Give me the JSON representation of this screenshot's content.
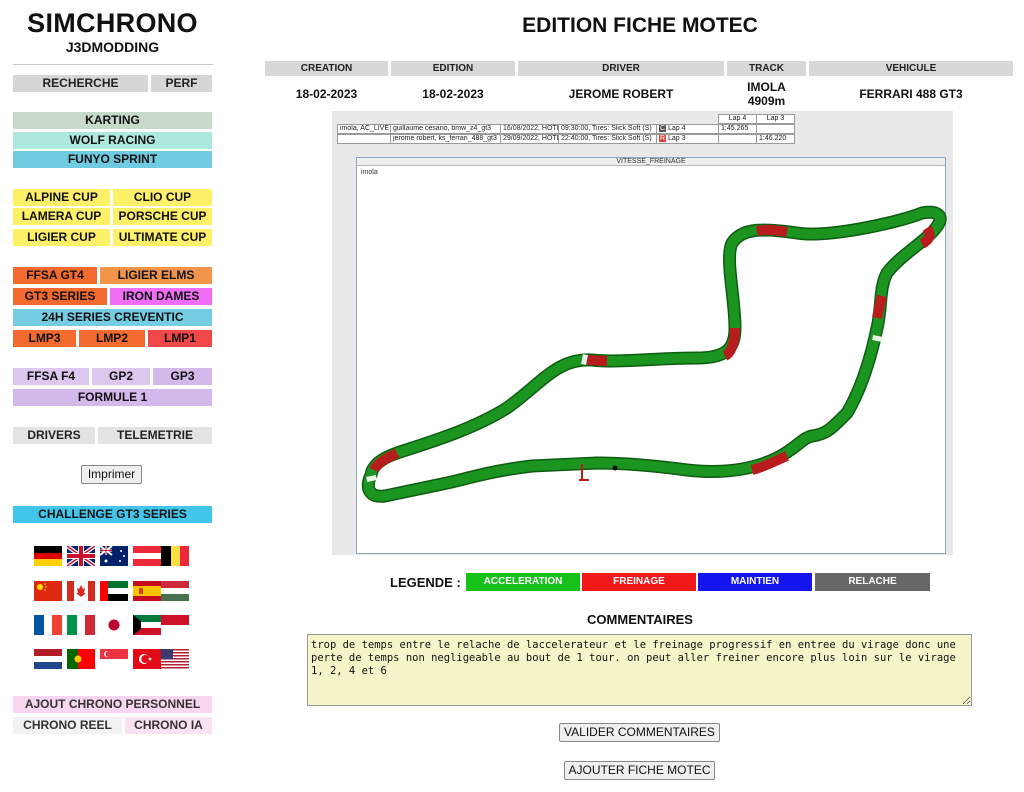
{
  "brand": {
    "title": "SIMCHRONO",
    "subtitle": "J3DMODDING"
  },
  "sidebar": {
    "recherche": "RECHERCHE",
    "perf": "PERF",
    "karting": "KARTING",
    "wolf_racing": "WOLF RACING",
    "funyo_sprint": "FUNYO SPRINT",
    "alpine_cup": "ALPINE CUP",
    "clio_cup": "CLIO CUP",
    "lamera_cup": "LAMERA CUP",
    "porsche_cup": "PORSCHE CUP",
    "ligier_cup": "LIGIER CUP",
    "ultimate_cup": "ULTIMATE CUP",
    "ffsa_gt4": "FFSA GT4",
    "ligier_elms": "LIGIER ELMS",
    "gt3_series": "GT3 SERIES",
    "iron_dames": "IRON DAMES",
    "creventic": "24H SERIES CREVENTIC",
    "lmp3": "LMP3",
    "lmp2": "LMP2",
    "lmp1": "LMP1",
    "ffsa_f4": "FFSA F4",
    "gp2": "GP2",
    "gp3": "GP3",
    "formule1": "FORMULE 1",
    "drivers": "DRIVERS",
    "telemetrie": "TELEMETRIE",
    "imprimer": "Imprimer",
    "challenge": "CHALLENGE GT3 SERIES",
    "ajout_chrono": "AJOUT CHRONO PERSONNEL",
    "chrono_reel": "CHRONO REEL",
    "chrono_ia": "CHRONO IA",
    "flags": [
      "germany-flag",
      "uk-flag",
      "australia-flag",
      "austria-flag",
      "belgium-flag",
      "china-flag",
      "canada-flag",
      "uae-flag",
      "spain-flag",
      "hungary-flag",
      "france-flag",
      "italy-flag",
      "japan-flag",
      "kuwait-flag",
      "monaco-flag",
      "netherlands-flag",
      "portugal-flag",
      "singapore-flag",
      "turkey-flag",
      "usa-flag"
    ]
  },
  "header": {
    "title": "EDITION FICHE MOTEC"
  },
  "info": {
    "headers": [
      "CREATION",
      "EDITION",
      "DRIVER",
      "TRACK",
      "VEHICULE"
    ],
    "creation": "18-02-2023",
    "edition": "18-02-2023",
    "driver": "JEROME ROBERT",
    "track_line1": "IMOLA",
    "track_line2": "4909m",
    "vehicule": "FERRARI 488 GT3"
  },
  "telemetry": {
    "lap4_header": "Lap 4",
    "lap3_header": "Lap 3",
    "row1": {
      "session": "imola, AC_LIVE",
      "driver": "guillaume cesano, bmw_z4_gt3",
      "date": "16/08/2022, HOTLAP",
      "time": "09:30:00, Tires: Slick Soft (S)",
      "lap_tag": "C",
      "lap": "Lap 4",
      "t1": "1:45.265",
      "t2": ""
    },
    "row2": {
      "session": "",
      "driver": "jerome robert, ks_ferrari_488_gt3",
      "date": "29/09/2022, HOTLAP",
      "time": "22:40:00, Tires: Slick Soft (S)",
      "lap_tag": "R",
      "lap": "Lap 3",
      "t1": "",
      "t2": "1:46.220"
    },
    "map_title": "VITESSE_FREINAGE",
    "map_label": "imola"
  },
  "legend": {
    "label": "LEGENDE :",
    "items": [
      {
        "label": "ACCELERATION",
        "color": "#16c21a"
      },
      {
        "label": "FREINAGE",
        "color": "#f01818"
      },
      {
        "label": "MAINTIEN",
        "color": "#1515ef"
      },
      {
        "label": "RELACHE",
        "color": "#676767"
      }
    ]
  },
  "comments": {
    "title": "COMMENTAIRES",
    "text": "trop de temps entre le relache de laccelerateur et le freinage progressif en entree du virage donc une perte de temps non negligeable au bout de 1 tour. on peut aller freiner encore plus loin sur le virage 1, 2, 4 et 6",
    "validate": "VALIDER COMMENTAIRES",
    "add_motec": "AJOUTER FICHE MOTEC"
  }
}
